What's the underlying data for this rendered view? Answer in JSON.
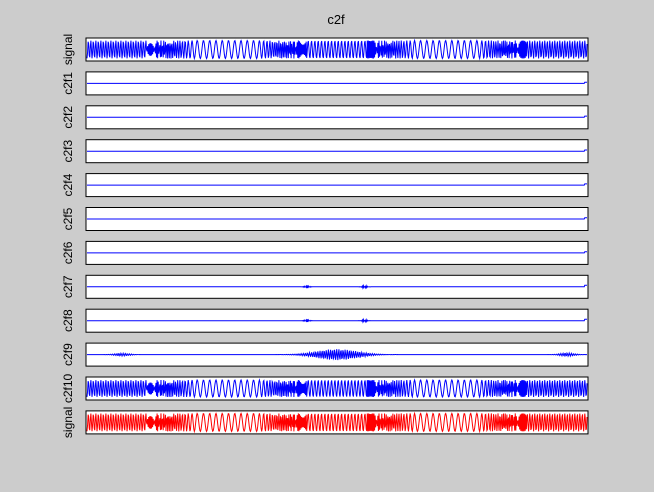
{
  "figure": {
    "background": "#cccccc",
    "axes_background": "#ffffff"
  },
  "chart_data": {
    "type": "line",
    "title": "c2f",
    "grid": false,
    "xticks": false,
    "yticks": false,
    "panels": [
      {
        "ylabel": "signal",
        "color": "#0000ff",
        "pattern": "chirp",
        "amplitude": 0.9
      },
      {
        "ylabel": "c2f1",
        "color": "#0000ff",
        "pattern": "flat",
        "amplitude": 0.0
      },
      {
        "ylabel": "c2f2",
        "color": "#0000ff",
        "pattern": "flat",
        "amplitude": 0.0
      },
      {
        "ylabel": "c2f3",
        "color": "#0000ff",
        "pattern": "flat",
        "amplitude": 0.0
      },
      {
        "ylabel": "c2f4",
        "color": "#0000ff",
        "pattern": "flat",
        "amplitude": 0.0
      },
      {
        "ylabel": "c2f5",
        "color": "#0000ff",
        "pattern": "flat",
        "amplitude": 0.0
      },
      {
        "ylabel": "c2f6",
        "color": "#0000ff",
        "pattern": "flat",
        "amplitude": 0.0
      },
      {
        "ylabel": "c2f7",
        "color": "#0000ff",
        "pattern": "blips",
        "amplitude": 0.15
      },
      {
        "ylabel": "c2f8",
        "color": "#0000ff",
        "pattern": "blips",
        "amplitude": 0.15
      },
      {
        "ylabel": "c2f9",
        "color": "#0000ff",
        "pattern": "burst",
        "amplitude": 0.55
      },
      {
        "ylabel": "c2f10",
        "color": "#0000ff",
        "pattern": "chirp",
        "amplitude": 0.85
      },
      {
        "ylabel": "signal",
        "color": "#ff0000",
        "pattern": "chirp",
        "amplitude": 0.9
      }
    ]
  }
}
